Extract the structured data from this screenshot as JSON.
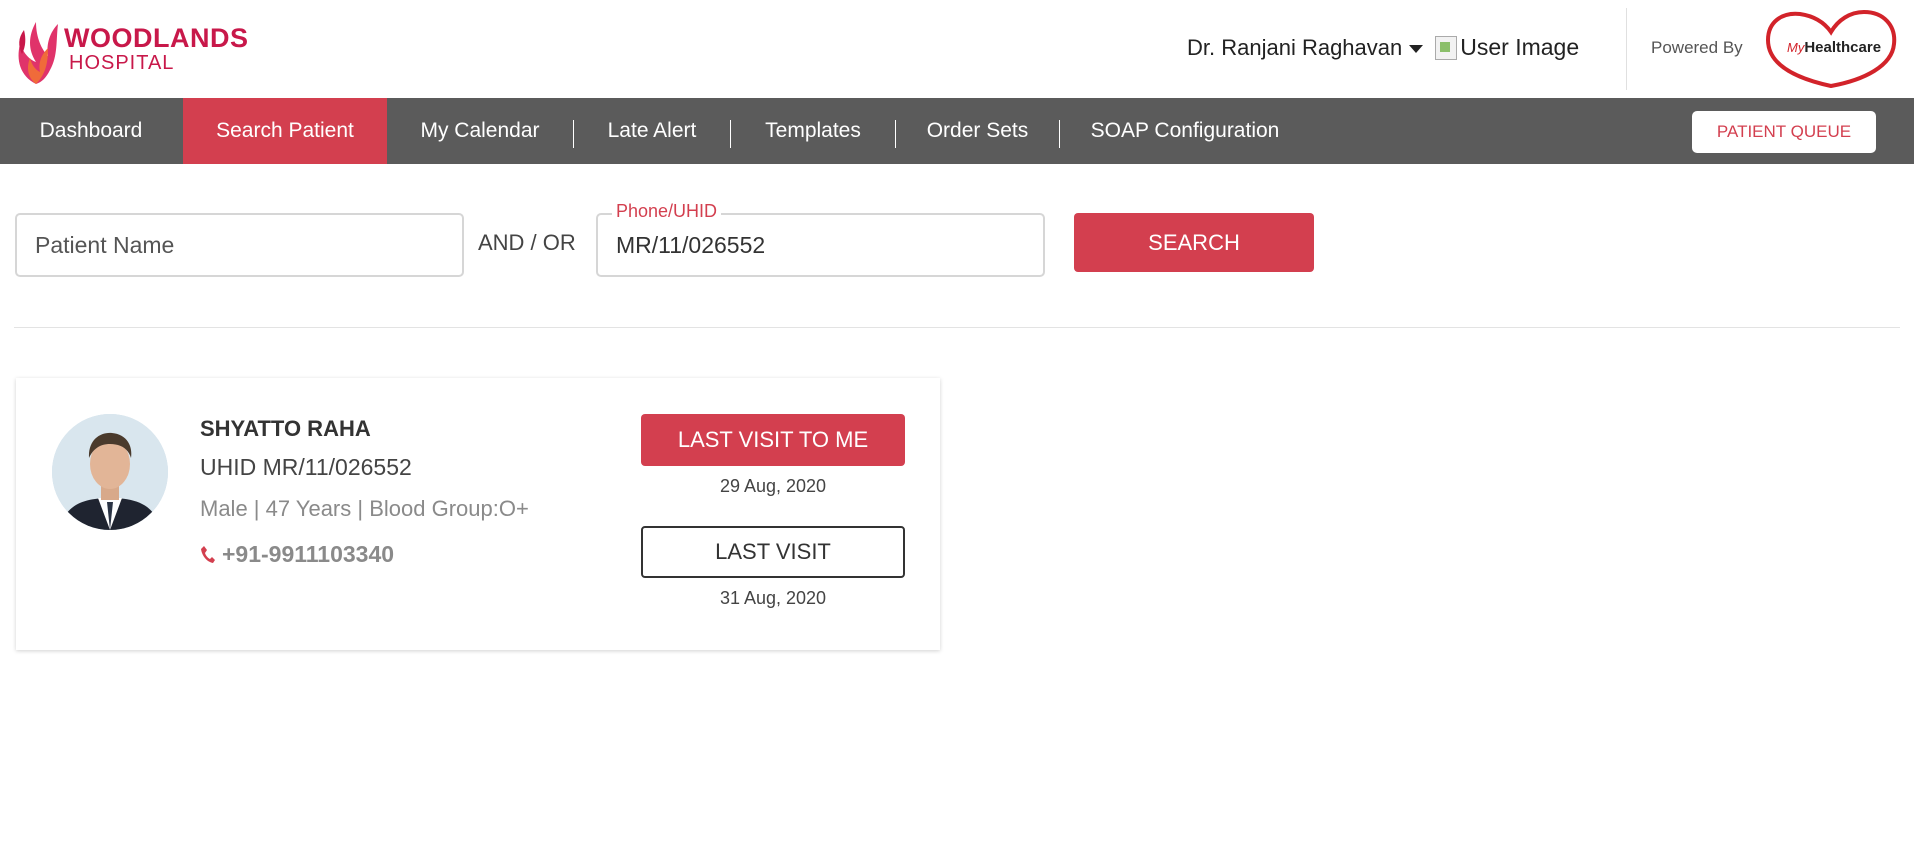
{
  "header": {
    "logo": {
      "line1": "WOODLANDS",
      "line2": "HOSPITAL"
    },
    "user": {
      "name": "Dr. Ranjani Raghavan",
      "image_alt": "User Image"
    },
    "powered_by": "Powered By",
    "partner_logo": {
      "prefix": "My",
      "name": "Healthcare"
    }
  },
  "nav": {
    "items": [
      {
        "label": "Dashboard",
        "active": false
      },
      {
        "label": "Search Patient",
        "active": true
      },
      {
        "label": "My Calendar",
        "active": false
      },
      {
        "label": "Late Alert",
        "active": false
      },
      {
        "label": "Templates",
        "active": false
      },
      {
        "label": "Order Sets",
        "active": false
      },
      {
        "label": "SOAP Configuration",
        "active": false
      }
    ],
    "queue_button": "PATIENT QUEUE"
  },
  "search": {
    "name_placeholder": "Patient Name",
    "name_value": "",
    "connector": "AND / OR",
    "phone_label": "Phone/UHID",
    "phone_value": "MR/11/026552",
    "button": "SEARCH"
  },
  "patient": {
    "name": "SHYATTO RAHA",
    "uhid": "UHID MR/11/026552",
    "meta": "Male | 47 Years | Blood Group:O+",
    "phone": "+91-9911103340",
    "last_visit_to_me_label": "LAST VISIT TO ME",
    "last_visit_to_me_date": "29 Aug, 2020",
    "last_visit_label": "LAST VISIT",
    "last_visit_date": "31 Aug, 2020"
  },
  "colors": {
    "brand": "#c8184a",
    "accent": "#d33f4f",
    "nav_bg": "#5b5b5b"
  },
  "icons": {
    "logo": "woodlands-flame-icon",
    "caret": "caret-down-icon",
    "phone": "phone-icon",
    "partner": "heart-logo-icon"
  }
}
